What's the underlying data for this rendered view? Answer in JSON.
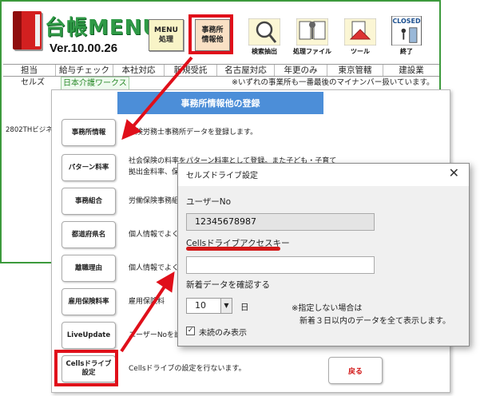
{
  "main": {
    "logo_title": "台帳MENU",
    "version": "Ver.10.00.26",
    "toolbar": {
      "menu_button": [
        "MENU",
        "処理"
      ],
      "office_button": [
        "事務所",
        "情報他"
      ],
      "search_label": "検索抽出",
      "process_label": "処理ファイル",
      "tool_label": "ツール",
      "closed_label_top": "CLOSED",
      "closed_label_bottom": "終了"
    },
    "columns": [
      "担当",
      "給与チェック",
      "本社対応",
      "新規受託",
      "名古屋対応",
      "年更のみ",
      "東京管轄",
      "建設業"
    ],
    "row1": {
      "tanto": "セルズ",
      "company": "日本介護ワークス",
      "note": "※いずれの事業所も一番最後のマイナンバー扱いています。"
    },
    "left_label": "2802THビジネ"
  },
  "office": {
    "title": "事務所情報他の登録",
    "buttons": [
      {
        "label": [
          "事務所情報"
        ],
        "desc": [
          "保険労務士事務所データを登録します。"
        ]
      },
      {
        "label": [
          "パターン料率"
        ],
        "desc": [
          "社会保険の料率をパターン料率として登録。また子ども・子育て",
          "拠出金料率、保"
        ]
      },
      {
        "label": [
          "事務組合"
        ],
        "desc": [
          "労働保険事務組"
        ]
      },
      {
        "label": [
          "都道府県名"
        ],
        "desc": [
          "個人情報でよく"
        ]
      },
      {
        "label": [
          "離職理由"
        ],
        "desc": [
          "個人情報でよく"
        ]
      },
      {
        "label": [
          "雇用保険料率"
        ],
        "desc": [
          "雇用保険料"
        ]
      },
      {
        "label": [
          "LiveUpdate"
        ],
        "desc": [
          "ユーザーNoを設"
        ]
      },
      {
        "label": [
          "Cellsドライブ",
          "設定"
        ],
        "desc": [
          "Cellsドライブの設定を行ないます。"
        ]
      }
    ],
    "back_button": "戻る"
  },
  "dialog": {
    "title": "セルズドライブ設定",
    "close_glyph": "✕",
    "user_no_label": "ユーザーNo",
    "user_no_value": "12345678987",
    "access_key_label": "Cellsドライブアクセスキー",
    "access_key_value": "",
    "new_data_label": "新着データを確認する",
    "days_value": "10",
    "days_unit": "日",
    "note_line1": "※指定しない場合は",
    "note_line2": "新着３日以内のデータを全て表示します。",
    "unread_only_label": "未読のみ表示",
    "unread_only_checked": true
  },
  "colors": {
    "highlight": "#e00f1a",
    "title_bar": "#4c8ed8",
    "logo_green": "#2f9a46",
    "frame_green": "#3c9a3c"
  }
}
